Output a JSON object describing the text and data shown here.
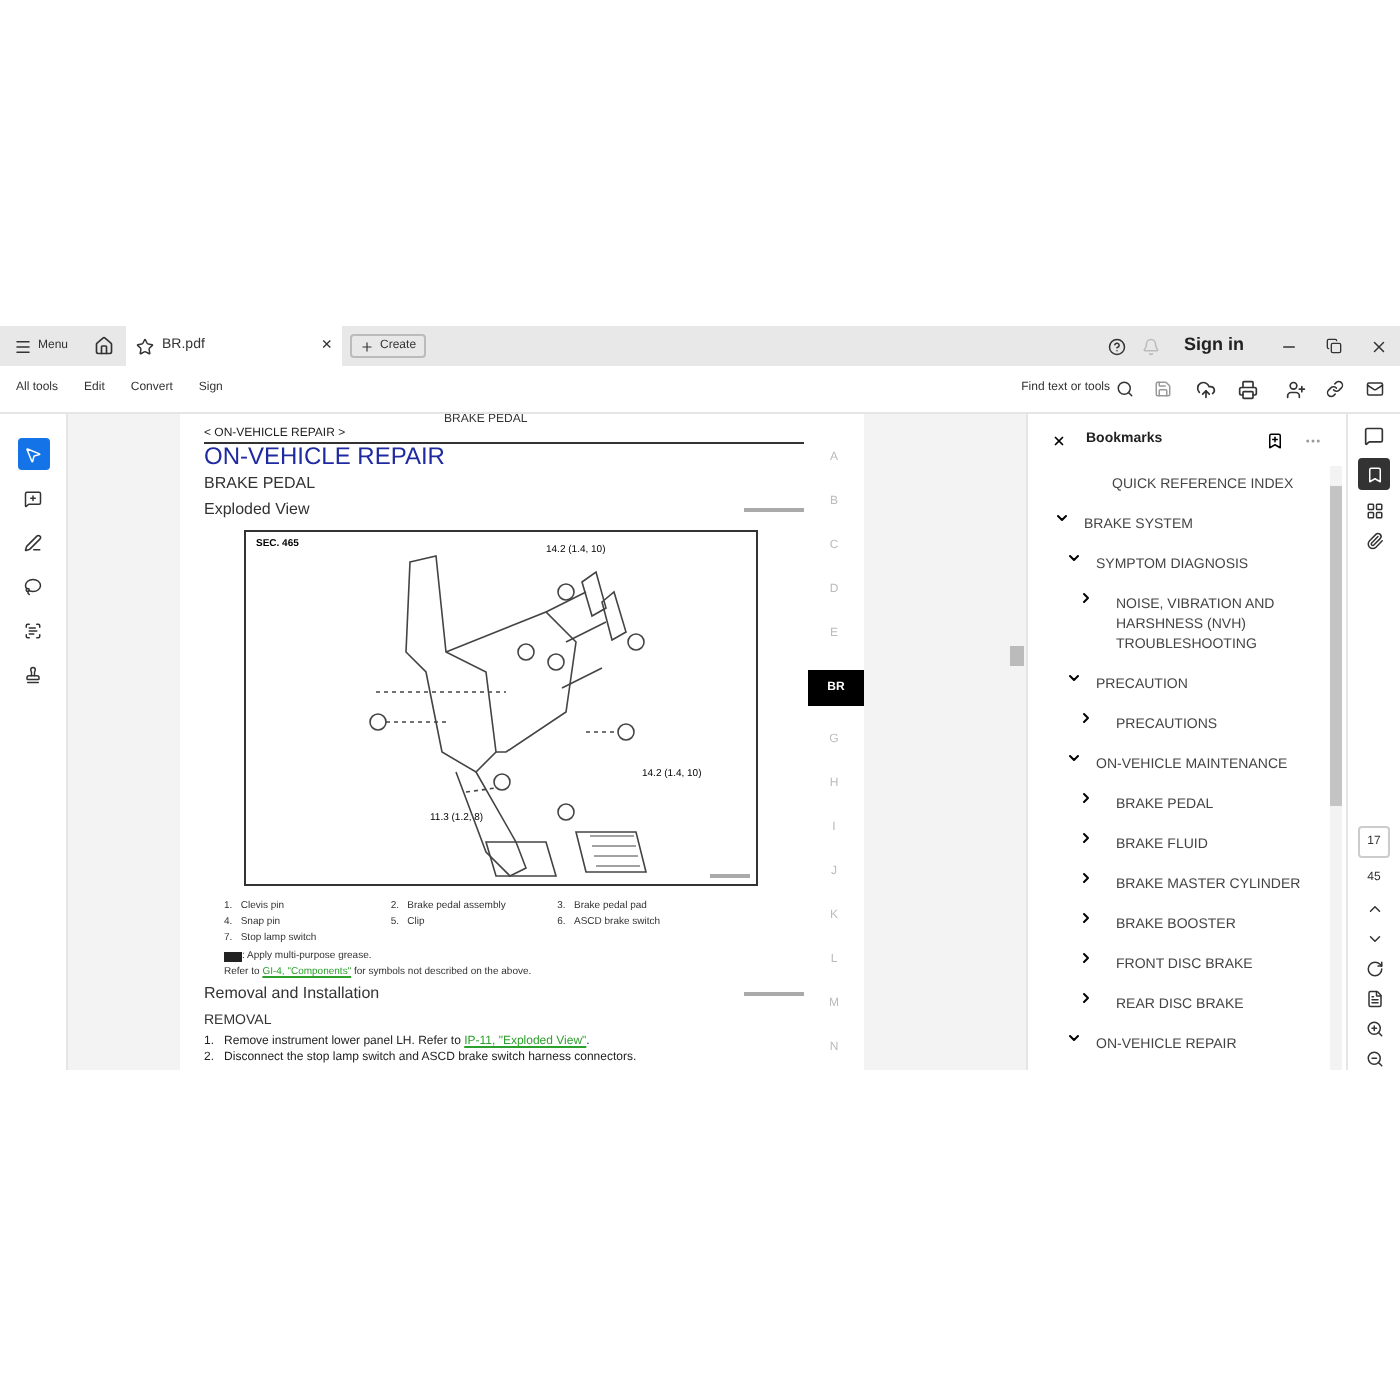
{
  "title_bar": {
    "menu": "Menu",
    "tab": {
      "title": "BR.pdf",
      "close": "×"
    },
    "create": "Create",
    "sign_in": "Sign in"
  },
  "toolbar": {
    "items": [
      "All tools",
      "Edit",
      "Convert",
      "Sign"
    ],
    "find": "Find text or tools"
  },
  "tools": [
    {
      "selected": true
    },
    {
      "selected": false
    },
    {
      "selected": false
    },
    {
      "selected": false
    },
    {
      "selected": false
    },
    {
      "selected": false
    }
  ],
  "page": {
    "running_head": "BRAKE PEDAL",
    "breadcrumb": "< ON-VEHICLE REPAIR >",
    "title": "ON-VEHICLE REPAIR",
    "subtitle": "BRAKE PEDAL",
    "section": "Exploded View",
    "figure": {
      "sec": "SEC. 465",
      "torques": [
        "14.2 (1.4, 10)",
        "14.2 (1.4, 10)",
        "11.3 (1.2, 8)"
      ]
    },
    "legend": [
      {
        "number": "1.",
        "text": "Clevis pin"
      },
      {
        "number": "2.",
        "text": "Brake pedal assembly"
      },
      {
        "number": "3.",
        "text": "Brake pedal pad"
      },
      {
        "number": "4.",
        "text": "Snap pin"
      },
      {
        "number": "5.",
        "text": "Clip"
      },
      {
        "number": "6.",
        "text": "ASCD brake switch"
      },
      {
        "number": "7.",
        "text": "Stop lamp switch"
      }
    ],
    "grease_note": ": Apply multi-purpose grease.",
    "refer": {
      "before": "Refer to ",
      "link": "GI-4, \"Components\"",
      "after": " for symbols not described on the above."
    },
    "section2": "Removal and Installation",
    "removal": "REMOVAL",
    "steps": [
      {
        "number": "1.",
        "before": "Remove instrument lower panel LH. Refer to ",
        "link": "IP-11, \"Exploded View\"",
        "after": "."
      },
      {
        "number": "2.",
        "before": "Disconnect the stop lamp switch and ASCD brake switch harness connectors."
      }
    ]
  },
  "section_index": [
    {
      "label": "A",
      "selected": false
    },
    {
      "label": "B",
      "selected": false
    },
    {
      "label": "C",
      "selected": false
    },
    {
      "label": "D",
      "selected": false
    },
    {
      "label": "E",
      "selected": false
    },
    {
      "label": "BR",
      "selected": true
    },
    {
      "label": "G",
      "selected": false
    },
    {
      "label": "H",
      "selected": false
    },
    {
      "label": "I",
      "selected": false
    },
    {
      "label": "J",
      "selected": false
    },
    {
      "label": "K",
      "selected": false
    },
    {
      "label": "L",
      "selected": false
    },
    {
      "label": "M",
      "selected": false
    },
    {
      "label": "N",
      "selected": false
    }
  ],
  "bookmarks": {
    "title": "Bookmarks",
    "items": [
      {
        "label": "QUICK REFERENCE INDEX"
      },
      {
        "label": "BRAKE SYSTEM",
        "expanded": true,
        "children": [
          {
            "label": "SYMPTOM DIAGNOSIS",
            "expanded": true,
            "children": [
              {
                "label": "NOISE, VIBRATION AND HARSHNESS (NVH) TROUBLESHOOTING",
                "expanded": false
              }
            ]
          },
          {
            "label": "PRECAUTION",
            "expanded": true,
            "children": [
              {
                "label": "PRECAUTIONS",
                "expanded": false
              }
            ]
          },
          {
            "label": "ON-VEHICLE MAINTENANCE",
            "expanded": true,
            "children": [
              {
                "label": "BRAKE PEDAL",
                "expanded": false
              },
              {
                "label": "BRAKE FLUID",
                "expanded": false
              },
              {
                "label": "BRAKE MASTER CYLINDER",
                "expanded": false
              },
              {
                "label": "BRAKE BOOSTER",
                "expanded": false
              },
              {
                "label": "FRONT DISC BRAKE",
                "expanded": false
              },
              {
                "label": "REAR DISC BRAKE",
                "expanded": false
              }
            ]
          },
          {
            "label": "ON-VEHICLE REPAIR",
            "expanded": true
          }
        ]
      }
    ]
  },
  "page_nav": {
    "current": "17",
    "total": "45"
  }
}
